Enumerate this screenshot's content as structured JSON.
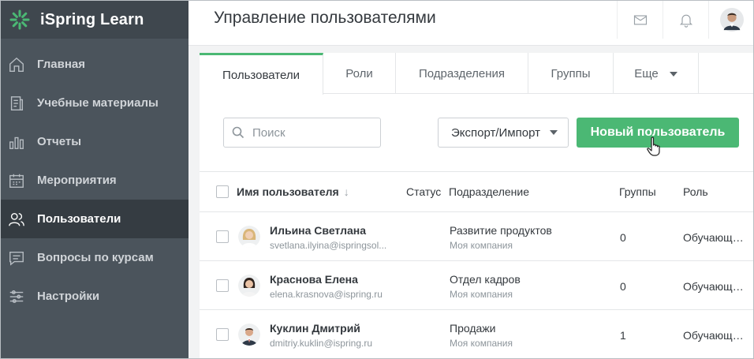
{
  "brand": {
    "name": "iSpring Learn",
    "accent": "#4bb874"
  },
  "sidebar": {
    "items": [
      {
        "label": "Главная",
        "icon": "home-icon",
        "active": false
      },
      {
        "label": "Учебные материалы",
        "icon": "document-icon",
        "active": false
      },
      {
        "label": "Отчеты",
        "icon": "bar-chart-icon",
        "active": false
      },
      {
        "label": "Мероприятия",
        "icon": "calendar-icon",
        "active": false
      },
      {
        "label": "Пользователи",
        "icon": "users-icon",
        "active": true
      },
      {
        "label": "Вопросы по курсам",
        "icon": "chat-icon",
        "active": false
      },
      {
        "label": "Настройки",
        "icon": "sliders-icon",
        "active": false
      }
    ]
  },
  "header": {
    "title": "Управление пользователями"
  },
  "tabs": [
    {
      "label": "Пользователи",
      "active": true
    },
    {
      "label": "Роли"
    },
    {
      "label": "Подразделения"
    },
    {
      "label": "Группы"
    },
    {
      "label": "Еще"
    }
  ],
  "toolbar": {
    "search_placeholder": "Поиск",
    "export_label": "Экспорт/Импорт",
    "new_user_label": "Новый пользователь"
  },
  "table": {
    "columns": {
      "name": "Имя пользователя",
      "status": "Статус",
      "department": "Подразделение",
      "groups": "Группы",
      "role": "Роль"
    },
    "rows": [
      {
        "name": "Ильина Светлана",
        "email": "svetlana.ilyina@ispringsol...",
        "department": "Развитие продуктов",
        "company": "Моя компания",
        "groups": "0",
        "role": "Обучающийся"
      },
      {
        "name": "Краснова Елена",
        "email": "elena.krasnova@ispring.ru",
        "department": "Отдел кадров",
        "company": "Моя компания",
        "groups": "0",
        "role": "Обучающийся"
      },
      {
        "name": "Куклин Дмитрий",
        "email": "dmitriy.kuklin@ispring.ru",
        "department": "Продажи",
        "company": "Моя компания",
        "groups": "1",
        "role": "Обучающийся"
      }
    ]
  }
}
